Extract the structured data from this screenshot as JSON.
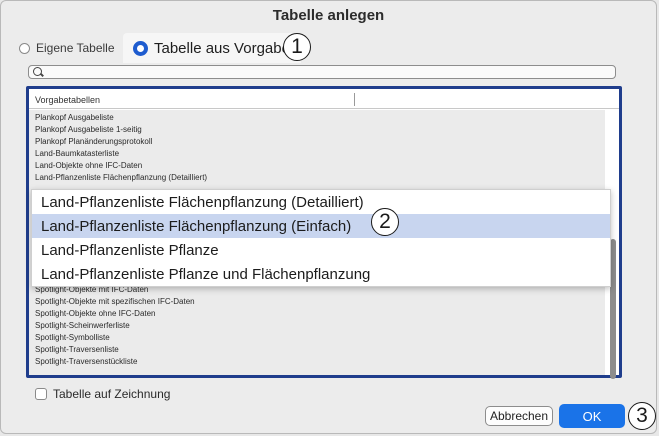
{
  "dialog": {
    "title": "Tabelle anlegen",
    "tabs": {
      "own_label": "Eigene Tabelle",
      "template_label": "Tabelle aus Vorgabe"
    },
    "search": {
      "placeholder": "",
      "value": ""
    },
    "list": {
      "header": "Vorgabetabellen",
      "rows_top": [
        "Plankopf Ausgabeliste",
        "Plankopf Ausgabeliste 1-seitig",
        "Plankopf Planänderungsprotokoll",
        "Land-Baumkatasterliste",
        "Land-Objekte ohne IFC-Daten",
        "Land-Pflanzenliste Flächenpflanzung (Detailliert)"
      ],
      "rows_bottom": [
        "Spotlight-Objekte mit IFC-Daten",
        "Spotlight-Objekte mit spezifischen IFC-Daten",
        "Spotlight-Objekte ohne IFC-Daten",
        "Spotlight-Scheinwerferliste",
        "Spotlight-Symbolliste",
        "Spotlight-Traversenliste",
        "Spotlight-Traversenstückliste"
      ]
    },
    "popup": {
      "items": [
        "Land-Pflanzenliste Flächenpflanzung (Detailliert)",
        "Land-Pflanzenliste Flächenpflanzung (Einfach)",
        "Land-Pflanzenliste Pflanze",
        "Land-Pflanzenliste Pflanze und Flächenpflanzung"
      ],
      "selected_index": 1
    },
    "checkbox_label": "Tabelle auf Zeichnung",
    "buttons": {
      "cancel": "Abbrechen",
      "ok": "OK"
    }
  },
  "callouts": [
    "1",
    "2",
    "3"
  ],
  "colors": {
    "accent": "#1a73e8",
    "selection": "#c8d5ef",
    "list_border": "#1f3d8c"
  }
}
